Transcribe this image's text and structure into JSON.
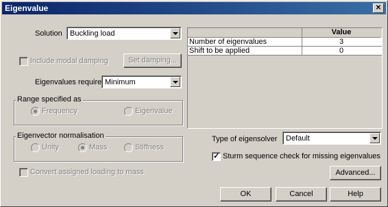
{
  "window": {
    "title": "Eigenvalue",
    "close_glyph": "✕"
  },
  "solution": {
    "label": "Solution",
    "value": "Buckling load"
  },
  "modal_damping": {
    "label": "Include modal damping",
    "checked": false,
    "enabled": false
  },
  "set_damping": {
    "label": "Set damping..."
  },
  "eigen_required": {
    "label": "Eigenvalues required",
    "value": "Minimum"
  },
  "range": {
    "title": "Range specified as",
    "options": [
      "Frequency",
      "Eigenvalue"
    ],
    "selected": "Frequency"
  },
  "normalisation": {
    "title": "Eigenvector normalisation",
    "options": [
      "Unity",
      "Mass",
      "Stiffness"
    ],
    "selected": "Mass"
  },
  "convert_loading": {
    "label": "Convert assigned loading to mass",
    "checked": false,
    "enabled": false
  },
  "table": {
    "header": "Value",
    "rows": [
      {
        "name": "Number of eigenvalues",
        "value": "3"
      },
      {
        "name": "Shift to be applied",
        "value": "0"
      }
    ]
  },
  "eigensolver": {
    "label": "Type of eigensolver",
    "value": "Default"
  },
  "sturm": {
    "label": "Sturm sequence check for missing eigenvalues",
    "checked": true
  },
  "buttons": {
    "advanced": "Advanced...",
    "ok": "OK",
    "cancel": "Cancel",
    "help": "Help"
  }
}
